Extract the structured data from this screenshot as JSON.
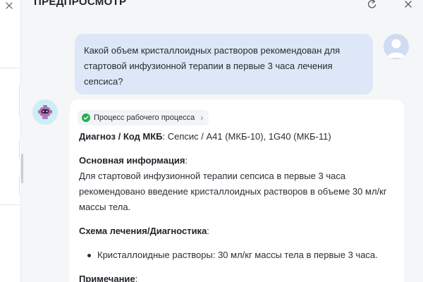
{
  "panel": {
    "title": "ПРЕДПРОСМОТР"
  },
  "chat": {
    "user_message": "Какой объем кристаллоидных растворов рекомендован для стартовой инфузионной терапии в первые 3 часа лечения сепсиса?",
    "process_label": "Процесс рабочего процесса",
    "answer": {
      "diagnosis_label": "Диагноз / Код МКБ",
      "diagnosis_value": ": Сепсис / A41 (МКБ-10), 1G40 (МКБ-11)",
      "info_label": "Основная информация",
      "info_colon": ":",
      "info_text": "Для стартовой инфузионной терапии сепсиса в первые 3 часа рекомендовано введение кристаллоидных растворов в объеме 30 мл/кг массы тела.",
      "scheme_label": "Схема лечения/Диагностика",
      "scheme_colon": ":",
      "scheme_items": [
        "Кристаллоидные растворы: 30 мл/кг массы тела в первые 3 часа."
      ],
      "note_label": "Примечание",
      "note_colon": ":"
    }
  },
  "icons": {
    "left_close": "close-icon",
    "refresh": "refresh-icon",
    "close": "close-icon",
    "check": "check-circle-icon",
    "chevron": "chevron-right-icon",
    "user_avatar": "user-avatar-icon",
    "bot_avatar": "robot-avatar-icon"
  },
  "colors": {
    "user_bubble": "#dde7f7",
    "success": "#1bb14f",
    "panel_bg": "#f5f6f8"
  }
}
